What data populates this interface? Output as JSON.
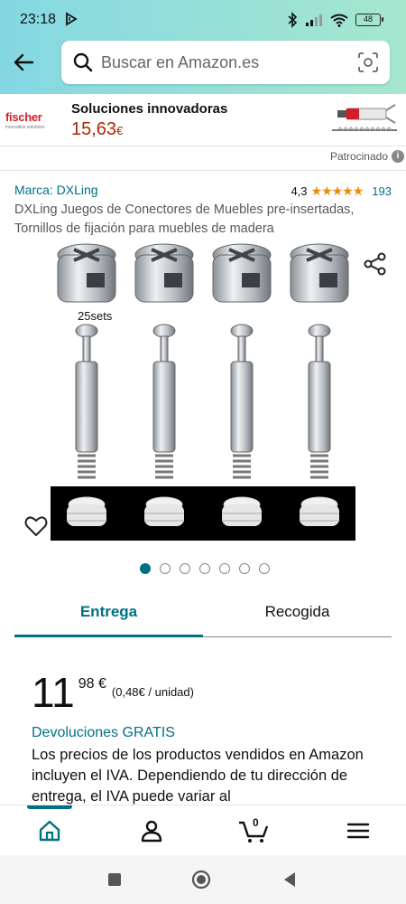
{
  "status_bar": {
    "time": "23:18",
    "battery": "48"
  },
  "search": {
    "placeholder": "Buscar en Amazon.es"
  },
  "ad": {
    "brand": "fischer",
    "tagline": "innovative solutions",
    "title": "Soluciones innovadoras",
    "price": "15,63",
    "currency": "€"
  },
  "sponsored_label": "Patrocinado",
  "product": {
    "brand_link": "Marca: DXLing",
    "rating_value": "4,3",
    "rating_stars": "★★★★★",
    "review_count": "193",
    "title": "DXLing Juegos de Conectores de Muebles pre-insertadas, Tornillos de fijación para muebles de madera",
    "image_caption": "25sets",
    "image_count": 7,
    "active_image": 1
  },
  "tabs": [
    {
      "label": "Entrega"
    },
    {
      "label": "Recogida"
    }
  ],
  "pricing": {
    "whole": "11",
    "fraction": "98 €",
    "unit_price": "(0,48€ / unidad)"
  },
  "returns_label": "Devoluciones GRATIS",
  "iva_text": "Los precios de los productos vendidos en Amazon incluyen el IVA. Dependiendo de tu dirección de entrega, el IVA puede variar al",
  "bottom_nav": {
    "cart_count": "0"
  },
  "colors": {
    "accent": "#007185",
    "price_red": "#B12704",
    "star": "#F08804",
    "header_from": "#84D8E3",
    "header_to": "#A6E7CE"
  }
}
